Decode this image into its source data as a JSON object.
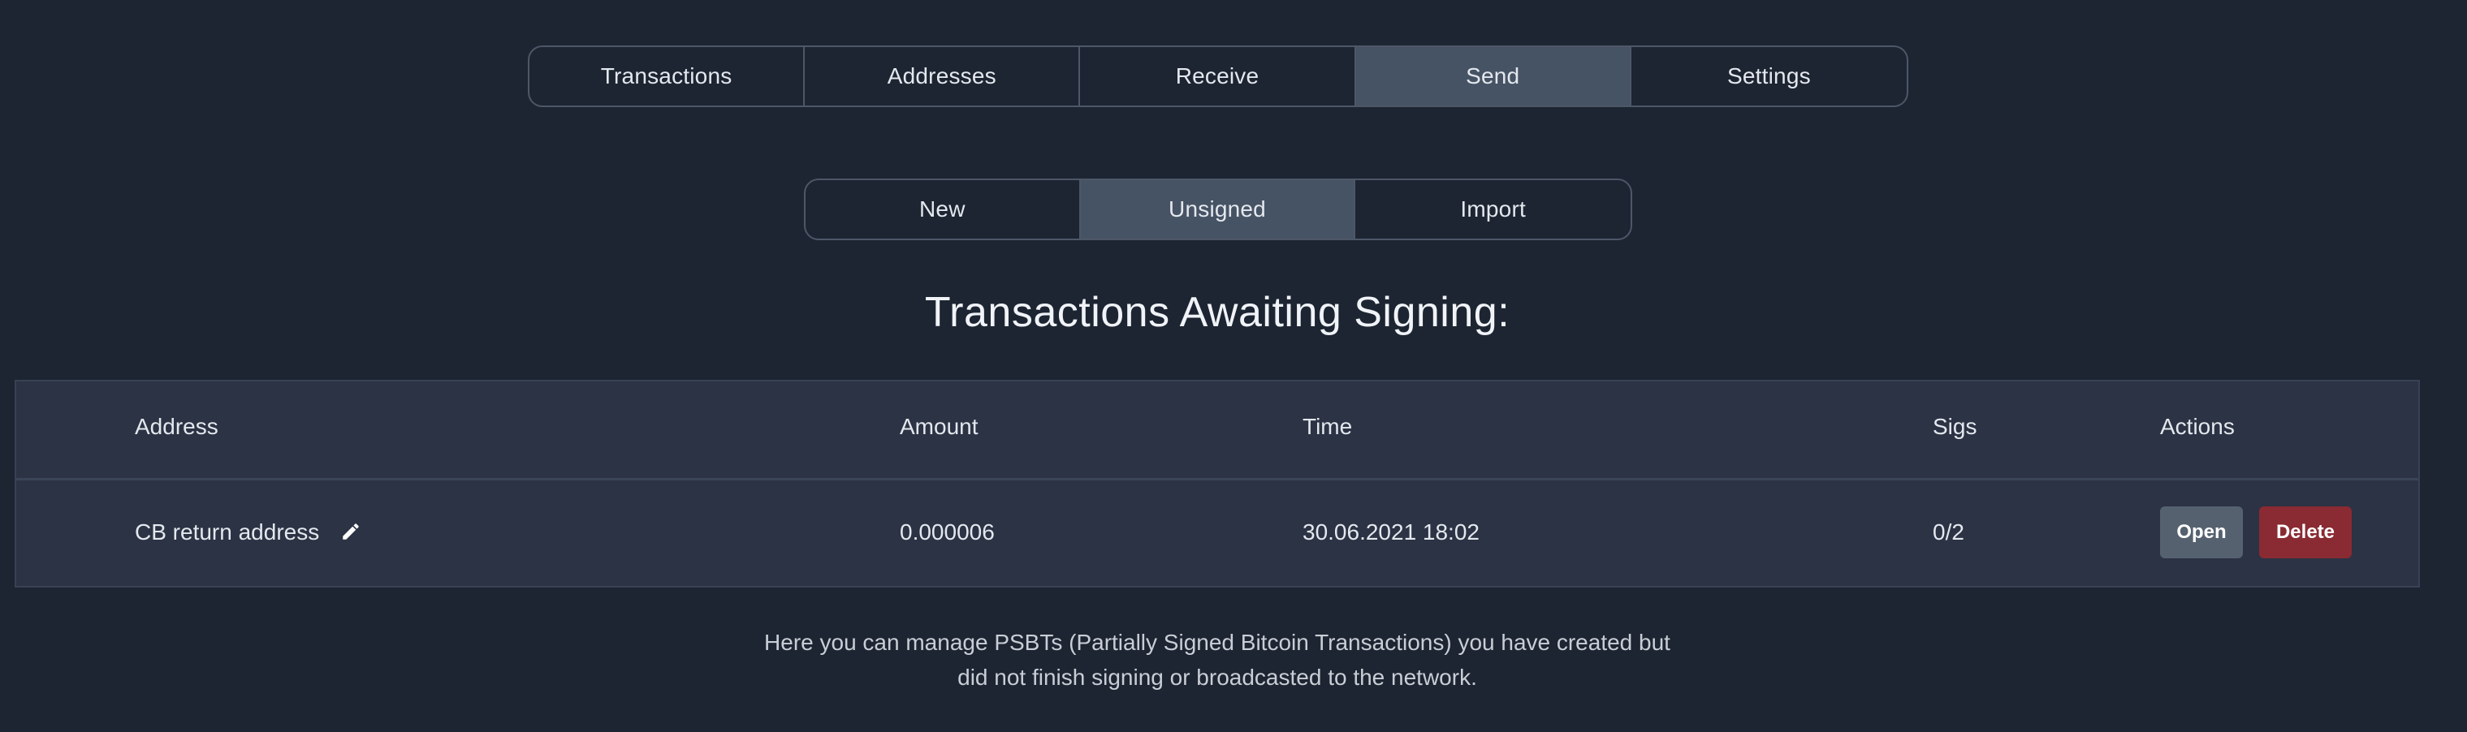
{
  "main_tabs": [
    {
      "label": "Transactions",
      "active": false
    },
    {
      "label": "Addresses",
      "active": false
    },
    {
      "label": "Receive",
      "active": false
    },
    {
      "label": "Send",
      "active": true
    },
    {
      "label": "Settings",
      "active": false
    }
  ],
  "sub_tabs": [
    {
      "label": "New",
      "active": false
    },
    {
      "label": "Unsigned",
      "active": true
    },
    {
      "label": "Import",
      "active": false
    }
  ],
  "heading": "Transactions Awaiting Signing:",
  "table": {
    "columns": [
      "Address",
      "Amount",
      "Time",
      "Sigs",
      "Actions"
    ],
    "rows": [
      {
        "address": "CB return address",
        "amount": "0.000006",
        "time": "30.06.2021 18:02",
        "sigs": "0/2",
        "open_label": "Open",
        "delete_label": "Delete"
      }
    ]
  },
  "footnote": {
    "line1": "Here you can manage PSBTs (Partially Signed Bitcoin Transactions) you have created but",
    "line2": "did not finish signing or broadcasted to the network."
  },
  "icons": {
    "edit": "pencil-icon"
  },
  "colors": {
    "background": "#1d2532",
    "table_bg": "#2b3344",
    "active_tab": "#465364",
    "open_button": "#55616f",
    "delete_button": "#8a2a33"
  }
}
